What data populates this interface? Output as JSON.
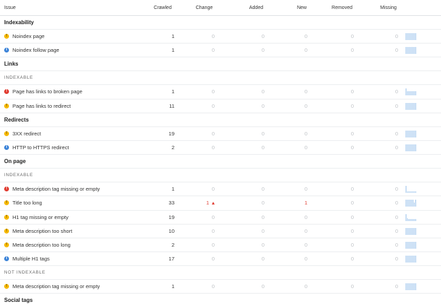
{
  "header": {
    "issue": "Issue",
    "crawled": "Crawled",
    "change": "Change",
    "added": "Added",
    "new": "New",
    "removed": "Removed",
    "missing": "Missing"
  },
  "colors": {
    "warning": "#f5b800",
    "error": "#e03c31",
    "notice": "#3d84d8",
    "spark": "#9dc4ec"
  },
  "sections": [
    {
      "title": "Indexability",
      "groups": [
        {
          "label": "",
          "rows": [
            {
              "icon": "warning",
              "issue": "Noindex page",
              "crawled": "1",
              "change": "0",
              "added": "0",
              "new": "0",
              "removed": "0",
              "missing": "0",
              "trend": [
                10,
                10,
                10,
                10,
                10,
                10,
                10,
                10
              ]
            },
            {
              "icon": "notice",
              "issue": "Noindex follow page",
              "crawled": "1",
              "change": "0",
              "added": "0",
              "new": "0",
              "removed": "0",
              "missing": "0",
              "trend": [
                10,
                10,
                10,
                10,
                10,
                10,
                10,
                10
              ]
            }
          ]
        }
      ]
    },
    {
      "title": "Links",
      "groups": [
        {
          "label": "INDEXABLE",
          "rows": [
            {
              "icon": "error",
              "issue": "Page has links to broken page",
              "crawled": "1",
              "change": "0",
              "added": "0",
              "new": "0",
              "removed": "0",
              "missing": "0",
              "trend": [
                10,
                6,
                6,
                6,
                6,
                6,
                6,
                6
              ]
            },
            {
              "icon": "warning",
              "issue": "Page has links to redirect",
              "crawled": "11",
              "change": "0",
              "added": "0",
              "new": "0",
              "removed": "0",
              "missing": "0",
              "trend": [
                10,
                10,
                10,
                10,
                10,
                10,
                10,
                10
              ]
            }
          ]
        }
      ]
    },
    {
      "title": "Redirects",
      "groups": [
        {
          "label": "",
          "rows": [
            {
              "icon": "warning",
              "issue": "3XX redirect",
              "crawled": "19",
              "change": "0",
              "added": "0",
              "new": "0",
              "removed": "0",
              "missing": "0",
              "trend": [
                10,
                10,
                10,
                10,
                10,
                10,
                10,
                10
              ]
            },
            {
              "icon": "notice",
              "issue": "HTTP to HTTPS redirect",
              "crawled": "2",
              "change": "0",
              "added": "0",
              "new": "0",
              "removed": "0",
              "missing": "0",
              "trend": [
                10,
                10,
                10,
                10,
                10,
                10,
                10,
                10
              ]
            }
          ]
        }
      ]
    },
    {
      "title": "On page",
      "groups": [
        {
          "label": "INDEXABLE",
          "rows": [
            {
              "icon": "error",
              "issue": "Meta description tag missing or empty",
              "crawled": "1",
              "change": "0",
              "added": "0",
              "new": "0",
              "removed": "0",
              "missing": "0",
              "trend": [
                10,
                2,
                2,
                2,
                2,
                2,
                2,
                2
              ]
            },
            {
              "icon": "warning",
              "issue": "Title too long",
              "crawled": "33",
              "change": "1",
              "change_up": true,
              "added": "0",
              "new": "1",
              "removed": "0",
              "missing": "0",
              "trend": [
                10,
                10,
                10,
                10,
                10,
                10,
                6,
                10
              ]
            },
            {
              "icon": "warning",
              "issue": "H1 tag missing or empty",
              "crawled": "19",
              "change": "0",
              "added": "0",
              "new": "0",
              "removed": "0",
              "missing": "0",
              "trend": [
                10,
                4,
                3,
                3,
                3,
                3,
                3,
                3
              ]
            },
            {
              "icon": "warning",
              "issue": "Meta description too short",
              "crawled": "10",
              "change": "0",
              "added": "0",
              "new": "0",
              "removed": "0",
              "missing": "0",
              "trend": [
                10,
                10,
                10,
                10,
                10,
                10,
                10,
                10
              ]
            },
            {
              "icon": "warning",
              "issue": "Meta description too long",
              "crawled": "2",
              "change": "0",
              "added": "0",
              "new": "0",
              "removed": "0",
              "missing": "0",
              "trend": [
                10,
                10,
                10,
                10,
                10,
                10,
                10,
                10
              ]
            },
            {
              "icon": "notice",
              "issue": "Multiple H1 tags",
              "crawled": "17",
              "change": "0",
              "added": "0",
              "new": "0",
              "removed": "0",
              "missing": "0",
              "trend": [
                10,
                10,
                10,
                10,
                10,
                10,
                10,
                10
              ]
            }
          ]
        },
        {
          "label": "NOT INDEXABLE",
          "rows": [
            {
              "icon": "warning",
              "issue": "Meta description tag missing or empty",
              "crawled": "1",
              "change": "0",
              "added": "0",
              "new": "0",
              "removed": "0",
              "missing": "0",
              "trend": [
                10,
                10,
                10,
                10,
                10,
                10,
                10,
                10
              ]
            }
          ]
        }
      ]
    },
    {
      "title": "Social tags",
      "groups": []
    }
  ]
}
